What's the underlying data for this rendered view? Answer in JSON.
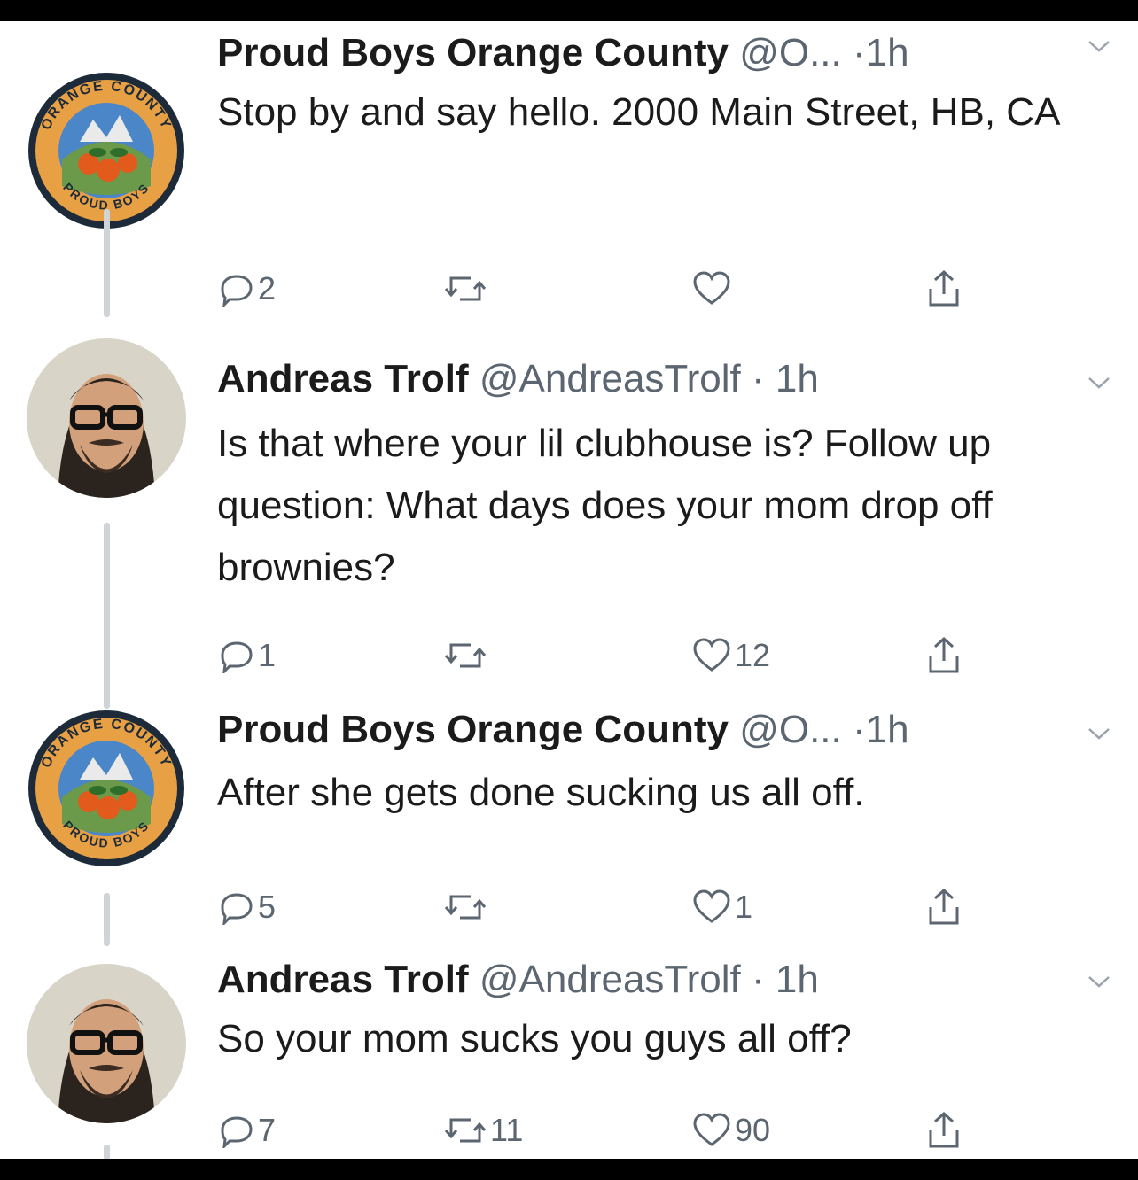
{
  "tweets": [
    {
      "name": "Proud Boys Orange County",
      "handle": "@O...",
      "dot": "·",
      "time": "1h",
      "text": "Stop by and say hello. 2000 Main Street, HB, CA",
      "replies": "2",
      "retweets": "",
      "likes": "",
      "avatar": "orange-county-logo"
    },
    {
      "name": "Andreas Trolf",
      "handle": "@AndreasTrolf",
      "dot": "·",
      "time": "1h",
      "text": "Is that where your lil clubhouse is? Follow up question: What days does your mom drop off brownies?",
      "replies": "1",
      "retweets": "",
      "likes": "12",
      "avatar": "man-with-glasses-photo"
    },
    {
      "name": "Proud Boys Orange County",
      "handle": "@O...",
      "dot": "·",
      "time": "1h",
      "text": "After she gets done sucking us all off.",
      "replies": "5",
      "retweets": "",
      "likes": "1",
      "avatar": "orange-county-logo"
    },
    {
      "name": "Andreas Trolf",
      "handle": "@AndreasTrolf",
      "dot": "·",
      "time": "1h",
      "text": "So your mom sucks you guys all off?",
      "replies": "7",
      "retweets": "11",
      "likes": "90",
      "avatar": "man-with-glasses-photo"
    }
  ],
  "logo": {
    "ring_top": "ORANGE COUNTY",
    "ring_bottom": "PROUD BOYS"
  },
  "colors": {
    "text": "#1b1b1b",
    "secondary": "#5c6670",
    "thread": "#cfd4d8",
    "logo_ring": "#e8a044"
  }
}
